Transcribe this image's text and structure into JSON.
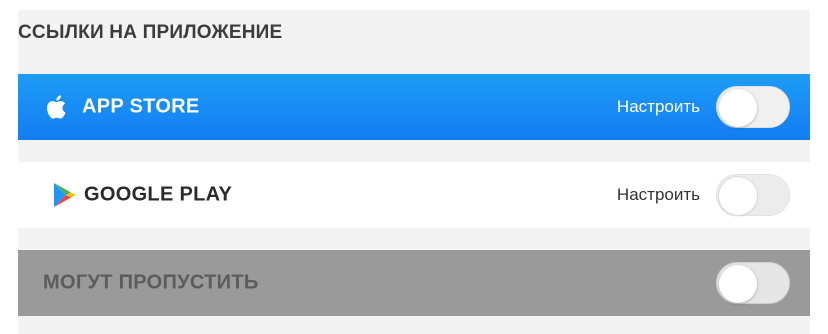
{
  "section": {
    "title": "ССЫЛКИ НА ПРИЛОЖЕНИЕ"
  },
  "rows": [
    {
      "label": "APP STORE",
      "icon": "apple-icon",
      "action_label": "Настроить",
      "enabled": false,
      "background": "#1a8ff5"
    },
    {
      "label": "GOOGLE PLAY",
      "icon": "google-play-icon",
      "action_label": "Настроить",
      "enabled": false,
      "background": "#ffffff"
    },
    {
      "label": "МОГУТ ПРОПУСТИТЬ",
      "enabled": false,
      "background": "#9a9a9a"
    }
  ]
}
